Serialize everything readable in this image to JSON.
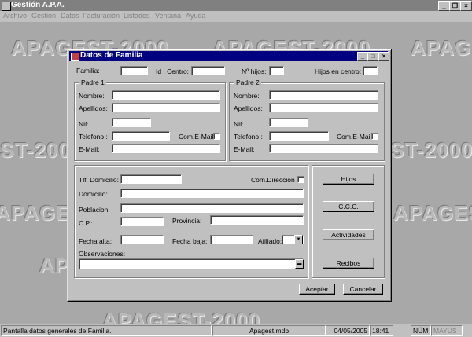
{
  "app": {
    "title": "Gestión A.P.A.",
    "window_controls": {
      "minimize": "_",
      "restore": "❐",
      "close": "×"
    }
  },
  "menu": [
    "Archivo",
    "Gestión",
    "Datos",
    "Facturación",
    "Listados",
    "Ventana",
    "Ayuda"
  ],
  "watermark": "APAGEST-2000",
  "watermark_fragments": [
    "APAGEST-2000",
    "APAGEST-2000",
    "APAGEST",
    "ST-2000",
    "ST-2000",
    "APAGEST-2000",
    "APAGEST-2000",
    "APAGEST-2000"
  ],
  "dialog": {
    "title": "Datos de Familia",
    "controls": {
      "minimize": "_",
      "maximize": "□",
      "close": "×"
    },
    "familia_label": "Familia:",
    "id_centro_label": "Id . Centro:",
    "n_hijos_label": "Nº hijos:",
    "hijos_centro_label": "Hijos en centro:",
    "padre1": {
      "legend": "Padre 1",
      "nombre": "Nombre:",
      "apellidos": "Apellidos:",
      "nif": "Nif:",
      "telefono": "Telefono :",
      "com_email": "Com.E-Mail",
      "email": "E-Mail:"
    },
    "padre2": {
      "legend": "Padre 2",
      "nombre": "Nombre:",
      "apellidos": "Apellidos:",
      "nif": "Nif:",
      "telefono": "Telefono :",
      "com_email": "Com.E-Mail",
      "email": "E-Mail:"
    },
    "address": {
      "tlf_domicilio": "Tlf. Domicilio:",
      "com_direccion": "Com.Dirección",
      "domicilio": "Domicilio:",
      "poblacion": "Poblacion:",
      "cp": "C.P.:",
      "provincia": "Provincia:",
      "fecha_alta": "Fecha alta:",
      "fecha_baja": "Fecha baja:",
      "afiliado": "Afiliado:",
      "observaciones": "Observaciones:"
    },
    "side_buttons": {
      "hijos": "Hijos",
      "ccc": "C.C.C.",
      "actividades": "Actividades",
      "recibos": "Recibos"
    },
    "aceptar": "Aceptar",
    "cancelar": "Cancelar"
  },
  "status": {
    "message": "Pantalla datos generales de Familia.",
    "database": "Apagest.mdb",
    "date": "04/05/2005",
    "time": "18:41",
    "num": "NÚM",
    "mayus": "MAYÚS"
  }
}
